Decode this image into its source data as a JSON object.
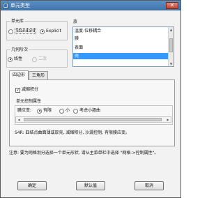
{
  "window": {
    "title": "单元类型",
    "close_label": "✕"
  },
  "element_library": {
    "legend": "单元库",
    "options": [
      "Standard",
      "Explicit"
    ],
    "selected": "Explicit"
  },
  "geometric_order": {
    "legend": "几何阶次",
    "options": [
      "线性",
      "二次"
    ],
    "selected": "线性"
  },
  "family": {
    "legend": "族",
    "items": [
      "温度-位移耦合",
      "膜",
      "表面",
      "壳"
    ],
    "selected": "壳"
  },
  "tabs": [
    "四边形",
    "三角形"
  ],
  "active_tab": "四边形",
  "quad_panel": {
    "reduced_integration_label": "减缩积分",
    "reduced_integration_checked": true,
    "controls_legend": "单元控制属性",
    "membrane_strain_label": "膜应变:",
    "membrane_options": [
      "有限",
      "小",
      "考虑小翘曲"
    ],
    "membrane_selected": "有限",
    "description": "S4R: 四结点曲面薄或厚壳, 减缩积分, 沙漏控制, 有限膜应变。"
  },
  "note": "注意: 要为网格划分选择一个单元形状, 请从主菜单栏中选择 \"网格->控制属性\"。",
  "buttons": {
    "ok": "确定",
    "defaults": "默认值",
    "cancel": "取消"
  }
}
